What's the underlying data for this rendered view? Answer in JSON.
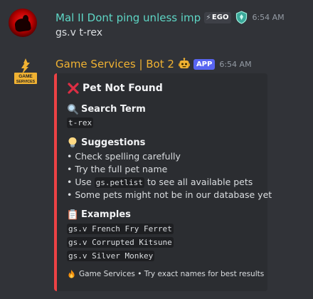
{
  "message1": {
    "username": "Mal II Dont ping unless imp",
    "badge": "EGO",
    "time": "6:54 AM",
    "content": "gs.v t-rex"
  },
  "message2": {
    "username": "Game Services | Bot 2",
    "app_badge": "APP",
    "time": "6:54 AM",
    "avatar_text_1": "GAME",
    "avatar_text_2": "SERVICES",
    "embed": {
      "accent_color": "#ed4245",
      "title": "Pet Not Found",
      "search_term": {
        "name": "Search Term",
        "value": "t-rex"
      },
      "suggestions": {
        "name": "Suggestions",
        "items": [
          "• Check spelling carefully",
          "• Try the full pet name",
          "• Use ",
          "• Some pets might not be in our database yet"
        ],
        "code": "gs.petlist",
        "after_code": " to see all available pets"
      },
      "examples": {
        "name": "Examples",
        "items": [
          "gs.v French Fry Ferret",
          "gs.v Corrupted Kitsune",
          "gs.v Silver Monkey"
        ]
      },
      "footer": "Game Services • Try exact names for best results"
    }
  },
  "colors": {
    "background": "#313338",
    "username1": "#5ed6c5",
    "username2": "#f0b232",
    "app_badge": "#5865f2"
  }
}
